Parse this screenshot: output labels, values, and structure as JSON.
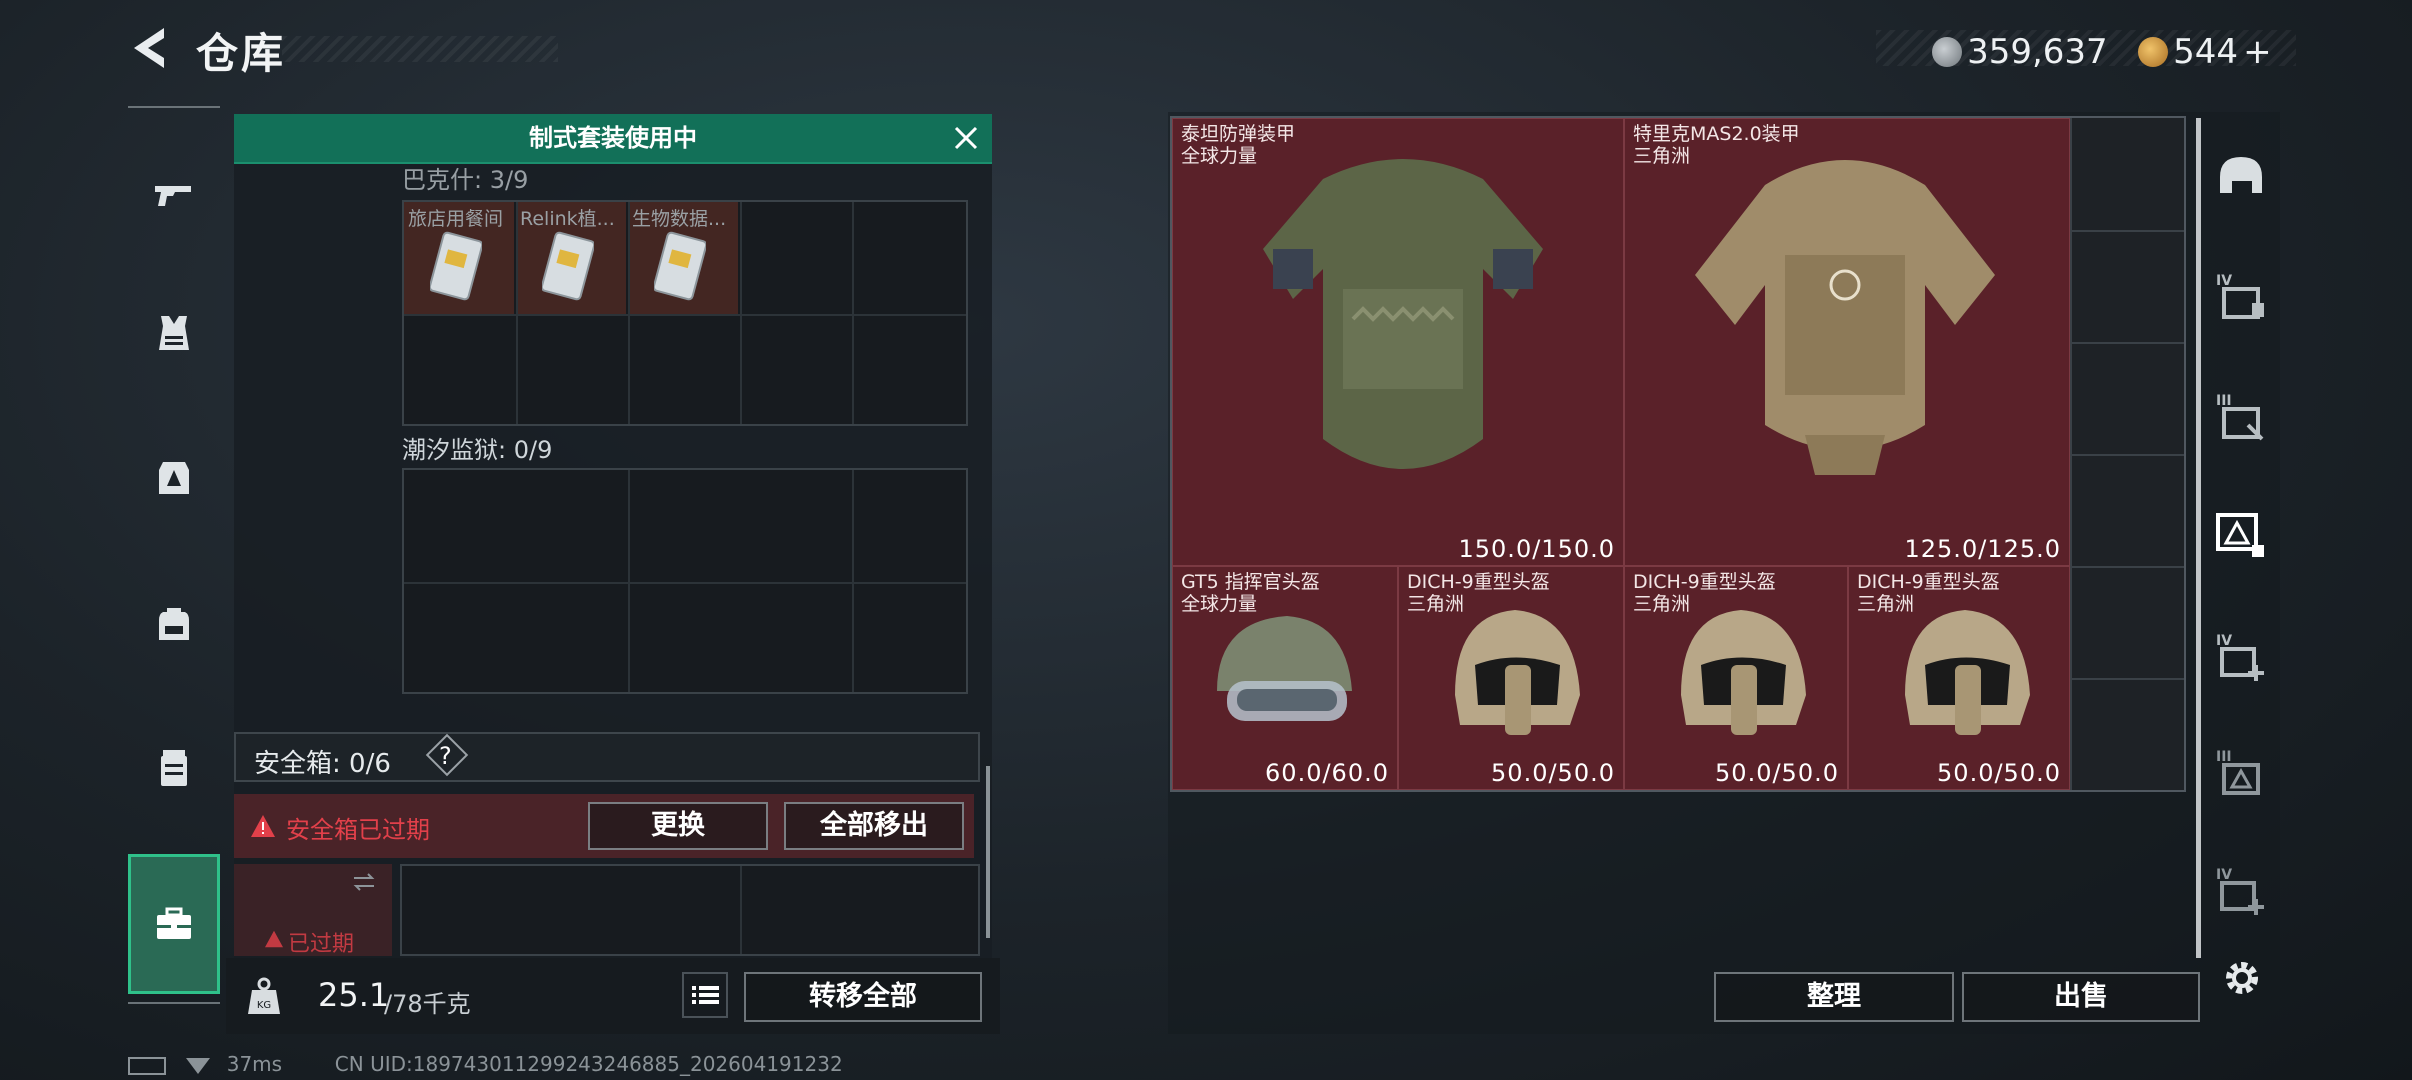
{
  "header": {
    "title": "仓库",
    "currency_primary": "359,637",
    "currency_secondary": "544",
    "add_symbol": "+"
  },
  "sidenav": {
    "items": [
      {
        "name": "weapons"
      },
      {
        "name": "armor-vest"
      },
      {
        "name": "chest-rig"
      },
      {
        "name": "backpack"
      },
      {
        "name": "case"
      },
      {
        "name": "toolbox",
        "active": true
      }
    ]
  },
  "storage": {
    "banner": "制式套装使用中",
    "section1_label": "巴克什: 3/9",
    "section1_items": [
      "旅店用餐间",
      "Relink植...",
      "生物数据..."
    ],
    "section2_label": "潮汐监狱: 0/9",
    "safe_box_label": "安全箱: 0/6",
    "safe_box_help": "?",
    "expired_alert": "安全箱已过期",
    "replace_button": "更换",
    "move_all_out_button": "全部移出",
    "expired_small": "已过期",
    "weight_current": "25.1",
    "weight_max": "/78千克",
    "transfer_all_button": "转移全部"
  },
  "inventory": {
    "items": [
      {
        "name": "泰坦防弹装甲",
        "origin": "全球力量",
        "durability": "150.0/150.0",
        "type": "armor"
      },
      {
        "name": "特里克MAS2.0装甲",
        "origin": "三角洲",
        "durability": "125.0/125.0",
        "type": "armor"
      },
      {
        "name": "GT5 指挥官头盔",
        "origin": "全球力量",
        "durability": "60.0/60.0",
        "type": "helmet"
      },
      {
        "name": "DICH-9重型头盔",
        "origin": "三角洲",
        "durability": "50.0/50.0",
        "type": "helmet"
      },
      {
        "name": "DICH-9重型头盔",
        "origin": "三角洲",
        "durability": "50.0/50.0",
        "type": "helmet"
      },
      {
        "name": "DICH-9重型头盔",
        "origin": "三角洲",
        "durability": "50.0/50.0",
        "type": "helmet"
      }
    ],
    "sort_button": "整理",
    "sell_button": "出售"
  },
  "filters": {
    "items": [
      {
        "icon": "helmet-icon"
      },
      {
        "icon": "armor-level-iv-icon",
        "label": "IV"
      },
      {
        "icon": "armor-level-iii-icon",
        "label": "III"
      },
      {
        "icon": "armor-level-selected-icon"
      },
      {
        "icon": "armor-add-iv-icon",
        "label": "IV"
      },
      {
        "icon": "armor-level-iii-icon",
        "label": "III"
      },
      {
        "icon": "armor-add-iv-icon",
        "label": "IV"
      }
    ]
  },
  "status_bar": {
    "ping": "37ms",
    "uid": "CN UID:18974301129924324688​5_202604191232"
  },
  "colors": {
    "accent_green": "#127058",
    "tile_red": "#5a2129",
    "alert_red": "#e2404a"
  }
}
